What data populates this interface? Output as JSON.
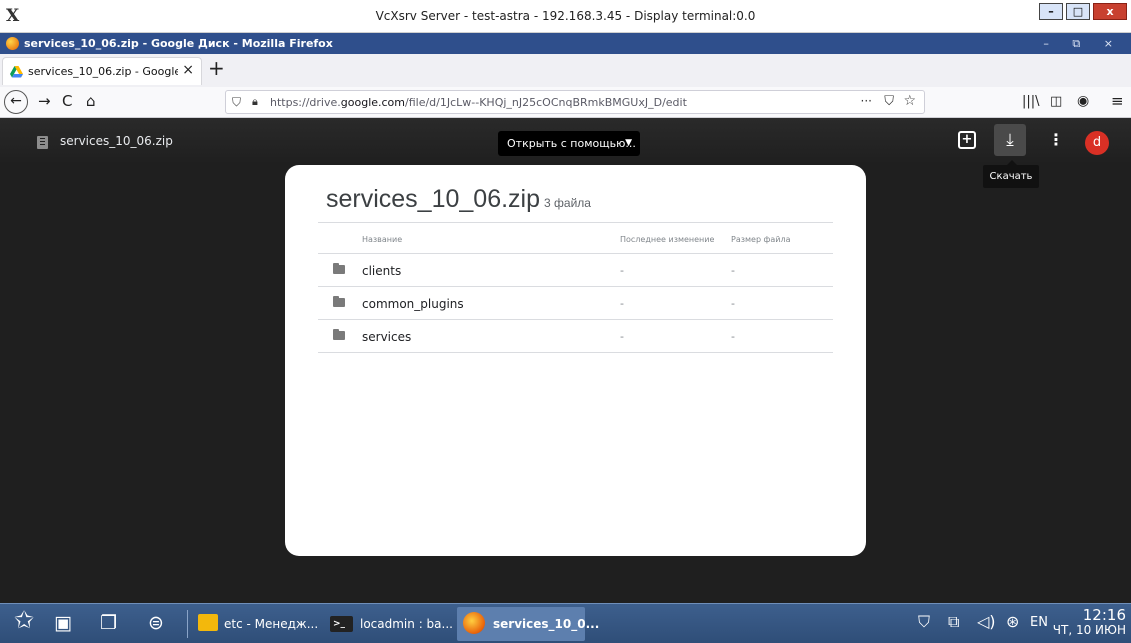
{
  "xsrv": {
    "logo": "X",
    "title": "VcXsrv Server - test-astra - 192.168.3.45 - Display terminal:0.0",
    "min": "–",
    "max": "□",
    "close": "x"
  },
  "firefox": {
    "window_title": "services_10_06.zip - Google Диск - Mozilla Firefox",
    "window_controls": "– ⧉ ×",
    "tab_label": "services_10_06.zip - Google",
    "tab_close": "×",
    "new_tab": "+",
    "url_prefix": "https://drive.",
    "url_domain": "google.com",
    "url_rest": "/file/d/1JcLw--KHQj_nJ25cOCnqBRmkBMGUxJ_D/edit",
    "url_more": "···"
  },
  "drive": {
    "file_name": "services_10_06.zip",
    "open_with": "Открыть с помощью...",
    "download_tooltip": "Скачать",
    "avatar_letter": "d",
    "zip_title": "services_10_06.zip",
    "zip_count": "3 файла",
    "columns": {
      "name": "Название",
      "modified": "Последнее изменение",
      "size": "Размер файла"
    },
    "rows": [
      {
        "name": "clients",
        "modified": "-",
        "size": "-"
      },
      {
        "name": "common_plugins",
        "modified": "-",
        "size": "-"
      },
      {
        "name": "services",
        "modified": "-",
        "size": "-"
      }
    ]
  },
  "taskbar": {
    "tasks": [
      {
        "label": "etc - Менедж..."
      },
      {
        "label": "locadmin : ba..."
      },
      {
        "label": "services_10_0..."
      }
    ],
    "lang": "EN",
    "time": "12:16",
    "date": "ЧТ, 10 ИЮН"
  }
}
